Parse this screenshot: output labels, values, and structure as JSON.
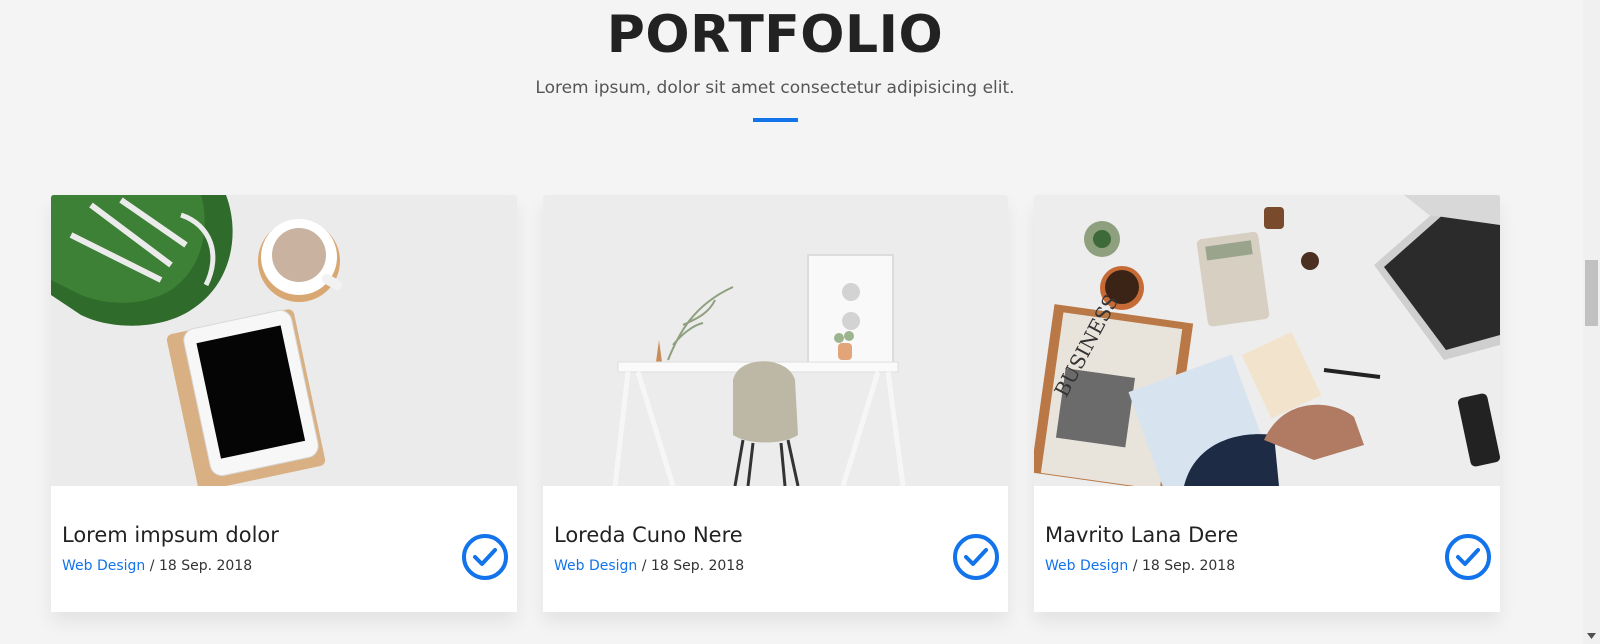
{
  "section": {
    "title": "PORTFOLIO",
    "subtitle": "Lorem ipsum, dolor sit amet consectetur adipisicing elit."
  },
  "colors": {
    "accent": "#1273eb",
    "background": "#f4f4f4",
    "card": "#ffffff"
  },
  "portfolio": {
    "items": [
      {
        "title": "Lorem impsum dolor",
        "category": "Web Design",
        "separator": " / ",
        "date": "18 Sep. 2018",
        "icon": "check-circle-icon"
      },
      {
        "title": "Loreda Cuno Nere",
        "category": "Web Design",
        "separator": " / ",
        "date": "18 Sep. 2018",
        "icon": "check-circle-icon"
      },
      {
        "title": "Mavrito Lana Dere",
        "category": "Web Design",
        "separator": " / ",
        "date": "18 Sep. 2018",
        "icon": "check-circle-icon"
      }
    ],
    "newspaper_text": "BUSINESS"
  }
}
